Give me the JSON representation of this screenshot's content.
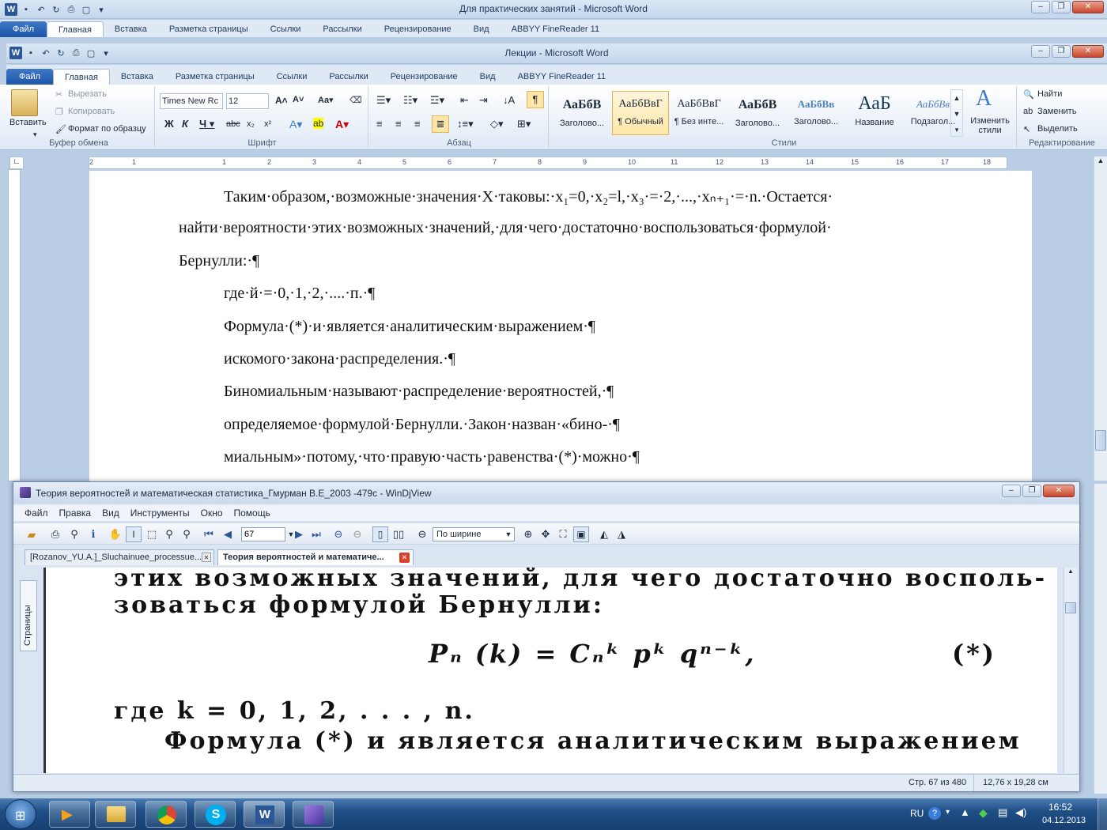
{
  "word_outer": {
    "title": "Для практических занятий  -  Microsoft Word",
    "tabs": [
      "Файл",
      "Главная",
      "Вставка",
      "Разметка страницы",
      "Ссылки",
      "Рассылки",
      "Рецензирование",
      "Вид",
      "ABBYY FineReader 11"
    ]
  },
  "word_inner": {
    "title": "Лекции  -  Microsoft Word",
    "tabs": [
      "Файл",
      "Главная",
      "Вставка",
      "Разметка страницы",
      "Ссылки",
      "Рассылки",
      "Рецензирование",
      "Вид",
      "ABBYY FineReader 11"
    ],
    "ribbon": {
      "clipboard": {
        "paste": "Вставить",
        "cut": "Вырезать",
        "copy": "Копировать",
        "format_painter": "Формат по образцу",
        "label": "Буфер обмена"
      },
      "font": {
        "name": "Times New Rc",
        "size": "12",
        "label": "Шрифт"
      },
      "paragraph": {
        "label": "Абзац"
      },
      "styles": {
        "label": "Стили",
        "items": [
          {
            "sample": "АаБбВ",
            "name": "Заголово..."
          },
          {
            "sample": "АаБбВвГ",
            "name": "¶ Обычный"
          },
          {
            "sample": "АаБбВвГ",
            "name": "¶ Без инте..."
          },
          {
            "sample": "АаБбВ",
            "name": "Заголово..."
          },
          {
            "sample": "АаБбВв",
            "name": "Заголово..."
          },
          {
            "sample": "АаБ",
            "name": "Название"
          },
          {
            "sample": "АаБбВв",
            "name": "Подзагол..."
          }
        ],
        "change_styles": "Изменить стили"
      },
      "editing": {
        "find": "Найти",
        "replace": "Заменить",
        "select": "Выделить",
        "label": "Редактирование"
      }
    },
    "ruler_numbers": [
      "2",
      "1",
      "1",
      "2",
      "3",
      "4",
      "5",
      "6",
      "7",
      "8",
      "9",
      "10",
      "11",
      "12",
      "13",
      "14",
      "15",
      "16",
      "17",
      "18"
    ],
    "document_lines": [
      "Таким·образом,·возможные·значения·X·таковы:·x₁=0,·x₂=l,·x₃·=·2,·...,·xₙ₊₁·=·n.·Остается·",
      "найти·вероятности·этих·возможных·значений,·для·чего·достаточно·воспользоваться·формулой·",
      "Бернулли:·¶",
      "где·й·=·0,·1,·2,·....·п.·¶",
      "Формула·(*)·и·является·аналитическим·выражением·¶",
      "искомого·закона·распределения.·¶",
      "Биномиальным·называют·распределение·вероятностей,·¶",
      "определяемое·формулой·Бернулли.·Закон·назван·«бино-·¶",
      "миальным»·потому,·что·правую·часть·равенства·(*)·можно·¶"
    ]
  },
  "djview": {
    "title": "Теория вероятностей и математическая статистика_Гмурман В.Е_2003 -479с - WinDjView",
    "menu": [
      "Файл",
      "Правка",
      "Вид",
      "Инструменты",
      "Окно",
      "Помощь"
    ],
    "page_input": "67",
    "zoom": "По ширине",
    "tabs": [
      "[Rozanov_YU.A.]_Sluchainuee_processue....",
      "Теория вероятностей и математиче..."
    ],
    "side_panel": "Страницы",
    "scan_lines": [
      "этих возможных значений, для чего достаточно восполь-",
      "зоваться формулой Бернулли:",
      "где  k = 0, 1, 2, . . . , n.",
      "Формула (*) и является аналитическим выражением"
    ],
    "formula": "Pₙ (k) = Cₙᵏ pᵏ qⁿ⁻ᵏ,",
    "formula_tag": "(*)",
    "status_page": "Стр. 67 из 480",
    "status_size": "12,76 x 19,28 см"
  },
  "taskbar": {
    "lang": "RU",
    "time": "16:52",
    "date": "04.12.2013"
  }
}
